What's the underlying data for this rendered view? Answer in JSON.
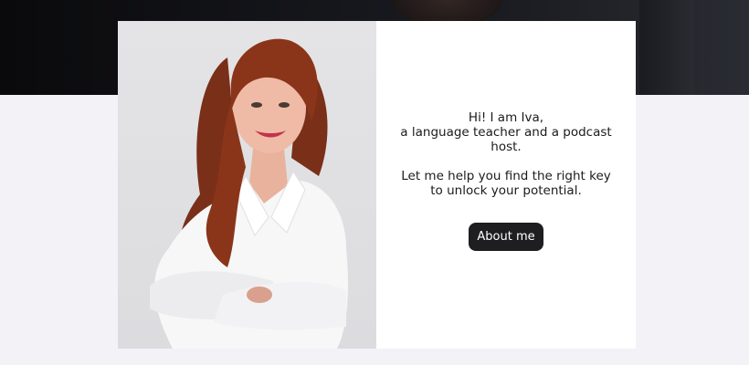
{
  "intro": {
    "line1": "Hi! I am Iva,",
    "line2": "a language teacher and a podcast host.",
    "line3": "Let me help you find the right key to unlock your potential."
  },
  "cta": {
    "about_label": "About me"
  },
  "colors": {
    "page_bg": "#f2f2f7",
    "button_bg": "#1e1e21",
    "button_text": "#ffffff"
  }
}
